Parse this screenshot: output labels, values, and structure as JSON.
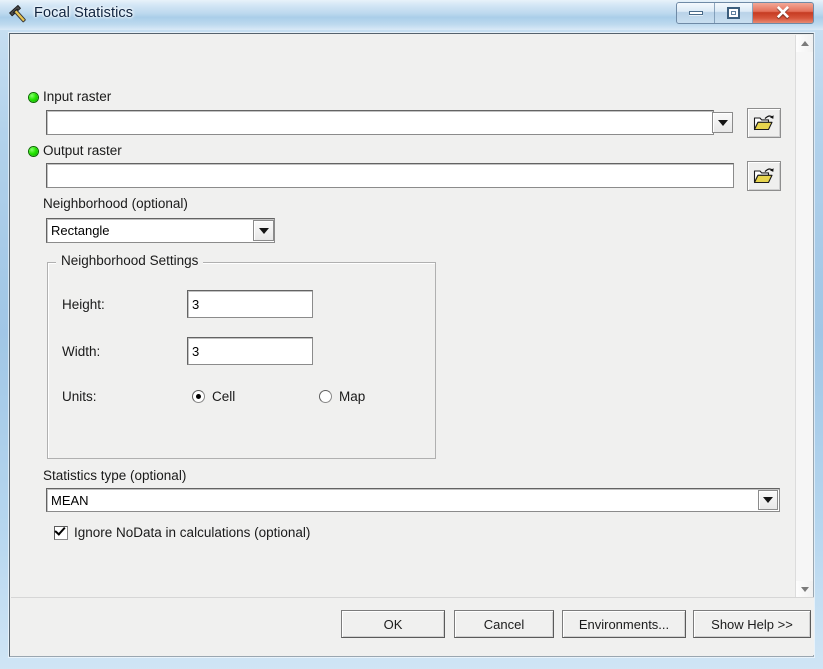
{
  "window": {
    "title": "Focal Statistics",
    "icon": "hammer-tool-icon",
    "controls": {
      "minimize": "minimize-icon",
      "maximize": "maximize-icon",
      "close": "close-icon",
      "close_glyph": "✕"
    }
  },
  "colors": {
    "required_dot": "#24e500",
    "dialog_bg": "#f0f0ef",
    "glass": "#a9cbe6",
    "close_button": "#c63b22"
  },
  "form": {
    "input_raster": {
      "label": "Input raster",
      "value": "",
      "placeholder": "",
      "required": true,
      "browse": "open-folder-icon",
      "dropdown": "chevron-down-icon"
    },
    "output_raster": {
      "label": "Output raster",
      "value": "",
      "placeholder": "",
      "required": true,
      "browse": "open-folder-icon"
    },
    "neighborhood": {
      "label": "Neighborhood (optional)",
      "value": "Rectangle",
      "dropdown": "chevron-down-icon"
    },
    "neighborhood_settings": {
      "group_title": "Neighborhood Settings",
      "height": {
        "label": "Height:",
        "value": "3"
      },
      "width": {
        "label": "Width:",
        "value": "3"
      },
      "units": {
        "label": "Units:",
        "selected": "Cell",
        "options": [
          {
            "label": "Cell",
            "checked": true
          },
          {
            "label": "Map",
            "checked": false
          }
        ]
      }
    },
    "statistics_type": {
      "label": "Statistics type (optional)",
      "value": "MEAN",
      "dropdown": "chevron-down-icon"
    },
    "ignore_nodata": {
      "label": "Ignore NoData in calculations (optional)",
      "checked": true
    }
  },
  "scrollbar": {
    "up": "scroll-up-arrow-icon",
    "down": "scroll-down-arrow-icon"
  },
  "buttons": {
    "ok": "OK",
    "cancel": "Cancel",
    "environments": "Environments...",
    "show_help": "Show Help >>"
  }
}
